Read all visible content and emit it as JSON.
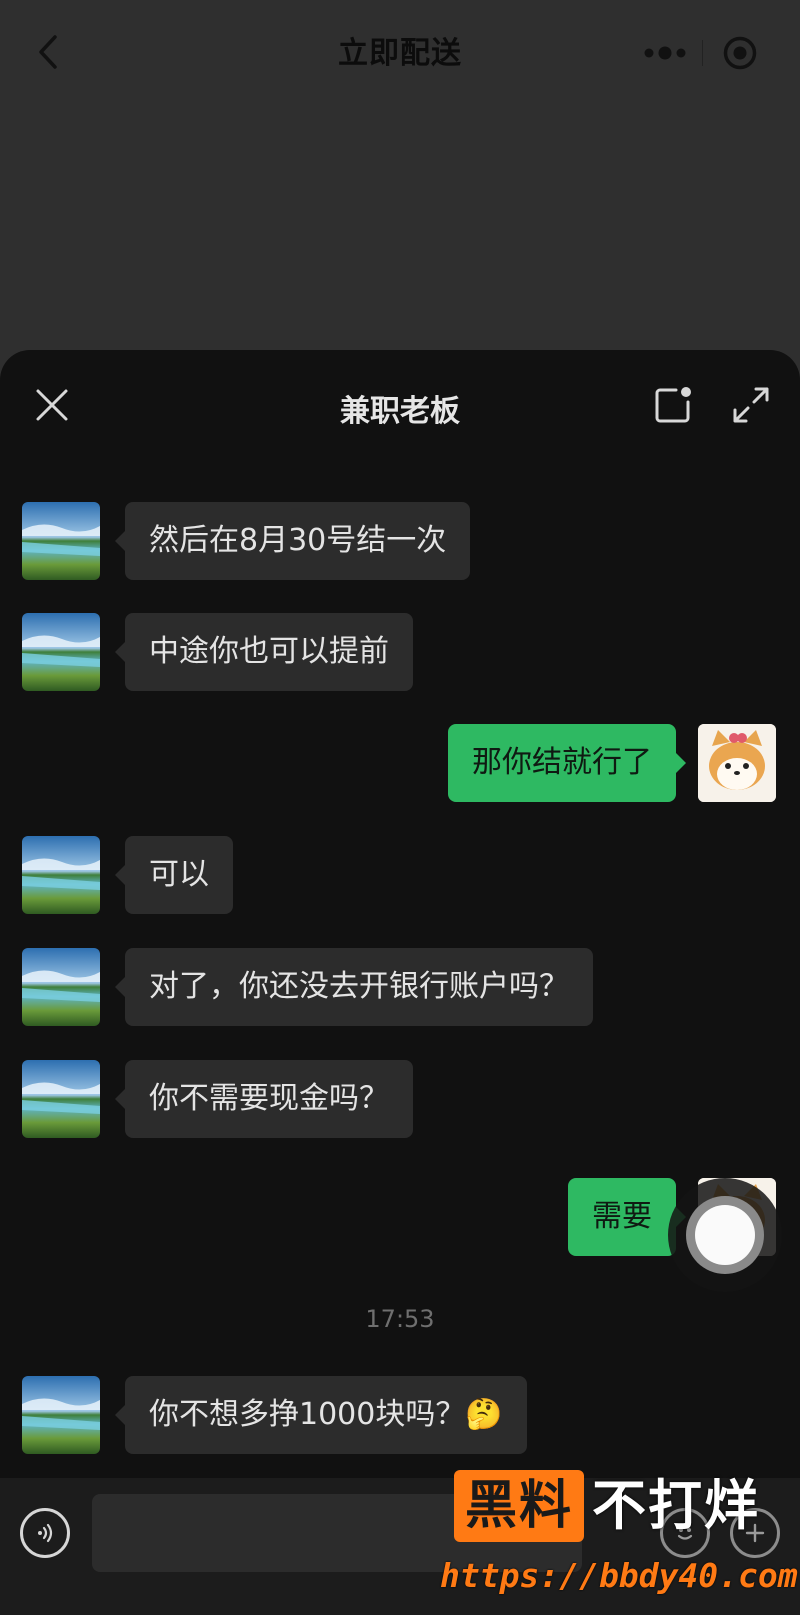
{
  "app": {
    "title": "立即配送",
    "capsule_icons": [
      "more-dots-icon",
      "close-target-icon"
    ]
  },
  "chat": {
    "title": "兼职老板",
    "header_icons": [
      "close-icon",
      "note-icon",
      "expand-icon"
    ],
    "timestamp": "17:53",
    "messages": [
      {
        "side": "in",
        "text": "然后在8月30号结一次"
      },
      {
        "side": "in",
        "text": "中途你也可以提前"
      },
      {
        "side": "out",
        "text": "那你结就行了"
      },
      {
        "side": "in",
        "text": "可以"
      },
      {
        "side": "in",
        "text": "对了，你还没去开银行账户吗？"
      },
      {
        "side": "in",
        "text": "你不需要现金吗？"
      },
      {
        "side": "out",
        "text": "需要"
      },
      {
        "side": "in",
        "text": "你不想多挣1000块吗？🤔"
      }
    ]
  },
  "input": {
    "value": "",
    "icons": [
      "voice-icon",
      "emoji-icon",
      "plus-icon"
    ]
  },
  "watermark": {
    "box_text": "黑料",
    "text": "不打烊",
    "url": "https://bbdy40.com"
  },
  "colors": {
    "page_bg": "#2f2f2f",
    "sheet_bg": "#111111",
    "bubble_in": "#2c2c2c",
    "bubble_out": "#2eb962",
    "watermark_orange": "#ff7a14"
  }
}
